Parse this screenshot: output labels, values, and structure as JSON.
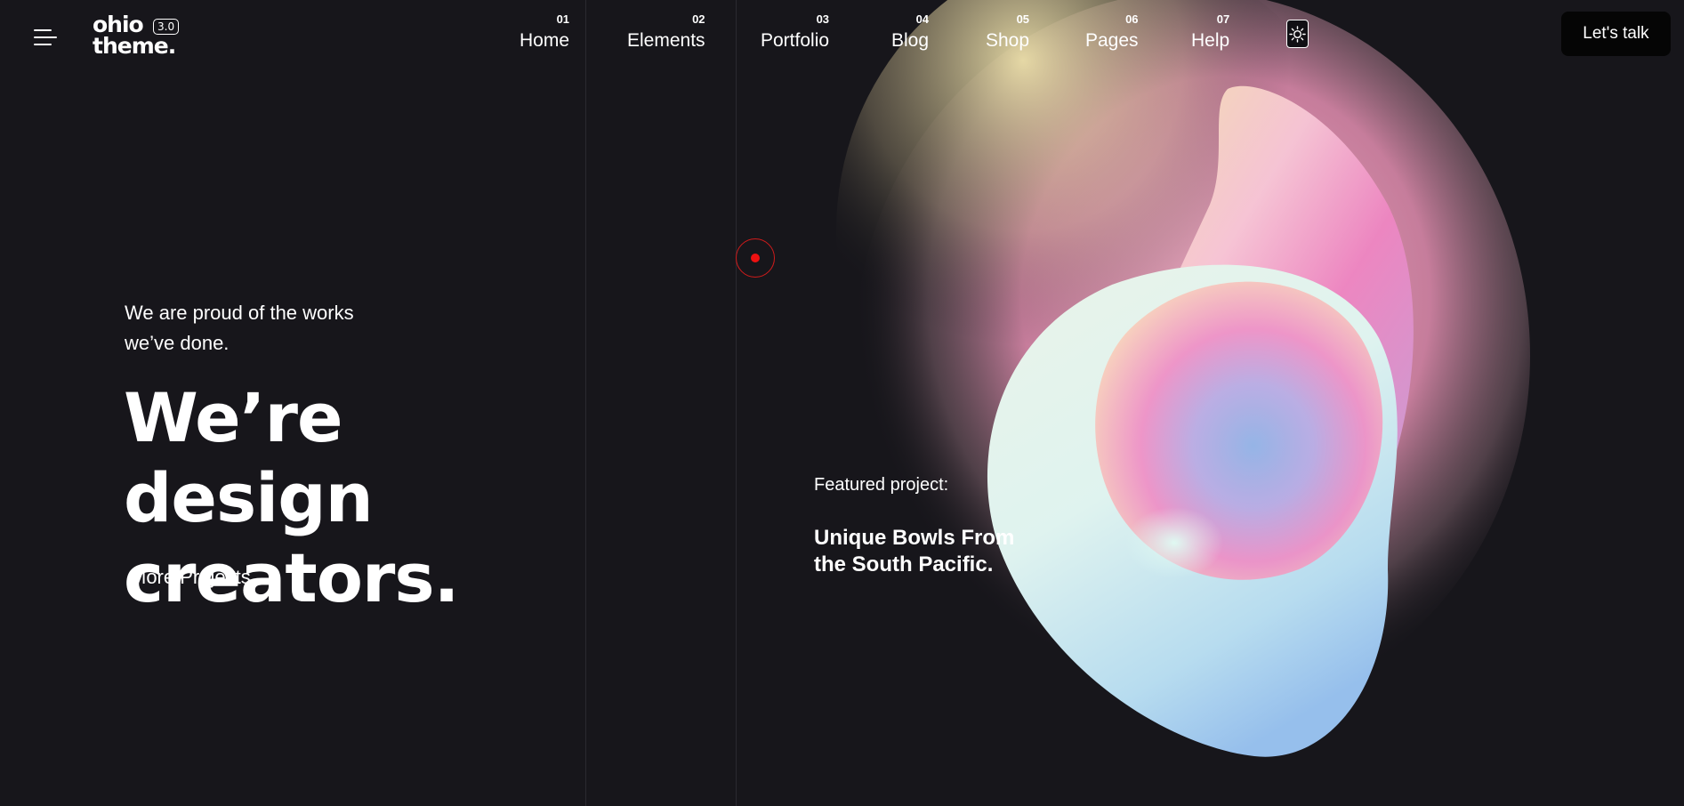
{
  "header": {
    "logo_line1": "ohio",
    "logo_line2": "theme.",
    "logo_version": "3.0",
    "nav": [
      {
        "num": "01",
        "label": "Home"
      },
      {
        "num": "02",
        "label": "Elements"
      },
      {
        "num": "03",
        "label": "Portfolio"
      },
      {
        "num": "04",
        "label": "Blog"
      },
      {
        "num": "05",
        "label": "Shop"
      },
      {
        "num": "06",
        "label": "Pages"
      },
      {
        "num": "07",
        "label": "Help"
      }
    ],
    "cta_label": "Let's talk"
  },
  "hero": {
    "subtitle_line1": "We are proud of the works",
    "subtitle_line2": "we’ve done.",
    "title_line1": "We’re design",
    "title_line2": "creators.",
    "link_label": "More Projects"
  },
  "featured": {
    "label": "Featured project:",
    "title_line1": "Unique Bowls From",
    "title_line2": "the South Pacific."
  },
  "colors": {
    "background": "#17161b",
    "text": "#ffffff",
    "cta_background": "#050505",
    "cursor": "#ee1111"
  },
  "icons": {
    "menu": "hamburger-icon",
    "theme": "sun-icon"
  }
}
